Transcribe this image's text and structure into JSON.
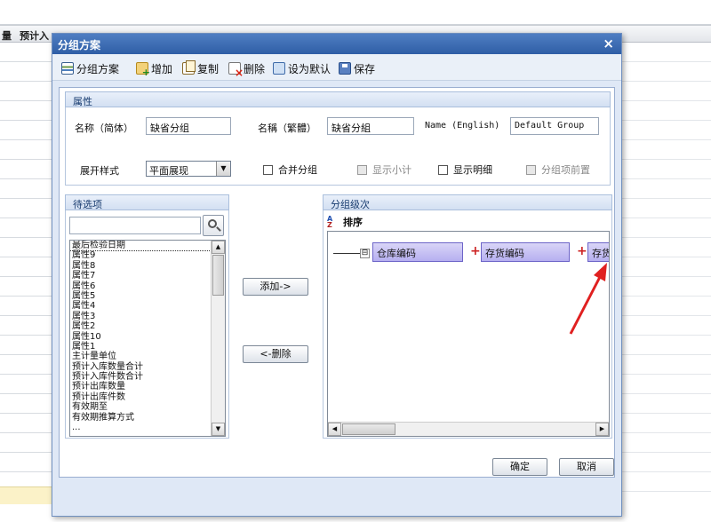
{
  "background": {
    "header_labels": [
      "量",
      "预计入"
    ]
  },
  "dialog": {
    "title": "分组方案",
    "close_glyph": "×",
    "toolbar": {
      "scheme": "分组方案",
      "add": "增加",
      "copy": "复制",
      "delete": "删除",
      "set_default": "设为默认",
      "save": "保存"
    },
    "properties": {
      "header": "属性",
      "name_simplified_label": "名称（简体）",
      "name_simplified_value": "缺省分组",
      "name_traditional_label": "名稱（繁體）",
      "name_traditional_value": "缺省分組",
      "name_english_label": "Name (English)",
      "name_english_value": "Default Group",
      "expand_style_label": "展开样式",
      "expand_style_value": "平面展现",
      "checkboxes": {
        "merge_group": "合并分组",
        "show_subtotal": "显示小计",
        "show_detail": "显示明细",
        "group_item_first": "分组项前置"
      }
    },
    "available": {
      "header": "待选项",
      "search_placeholder": "",
      "items": [
        "最后检验日期",
        "属性9",
        "属性8",
        "属性7",
        "属性6",
        "属性5",
        "属性4",
        "属性3",
        "属性2",
        "属性10",
        "属性1",
        "主计量单位",
        "预计入库数量合计",
        "预计入库件数合计",
        "预计出库数量",
        "预计出库件数",
        "有效期至",
        "有效期推算方式",
        "..."
      ]
    },
    "add_button": "添加->",
    "remove_button": "<-删除",
    "levels": {
      "header": "分组级次",
      "sort_label": "排序",
      "tree_box": "⊟",
      "nodes": [
        "仓库编码",
        "存货编码",
        "存货"
      ],
      "plus": "+"
    },
    "ok_button": "确定",
    "cancel_button": "取消"
  },
  "colors": {
    "title_bar": "#2f5ea6",
    "node_fill": "#b6aff0",
    "annotation_arrow": "#e02020"
  }
}
